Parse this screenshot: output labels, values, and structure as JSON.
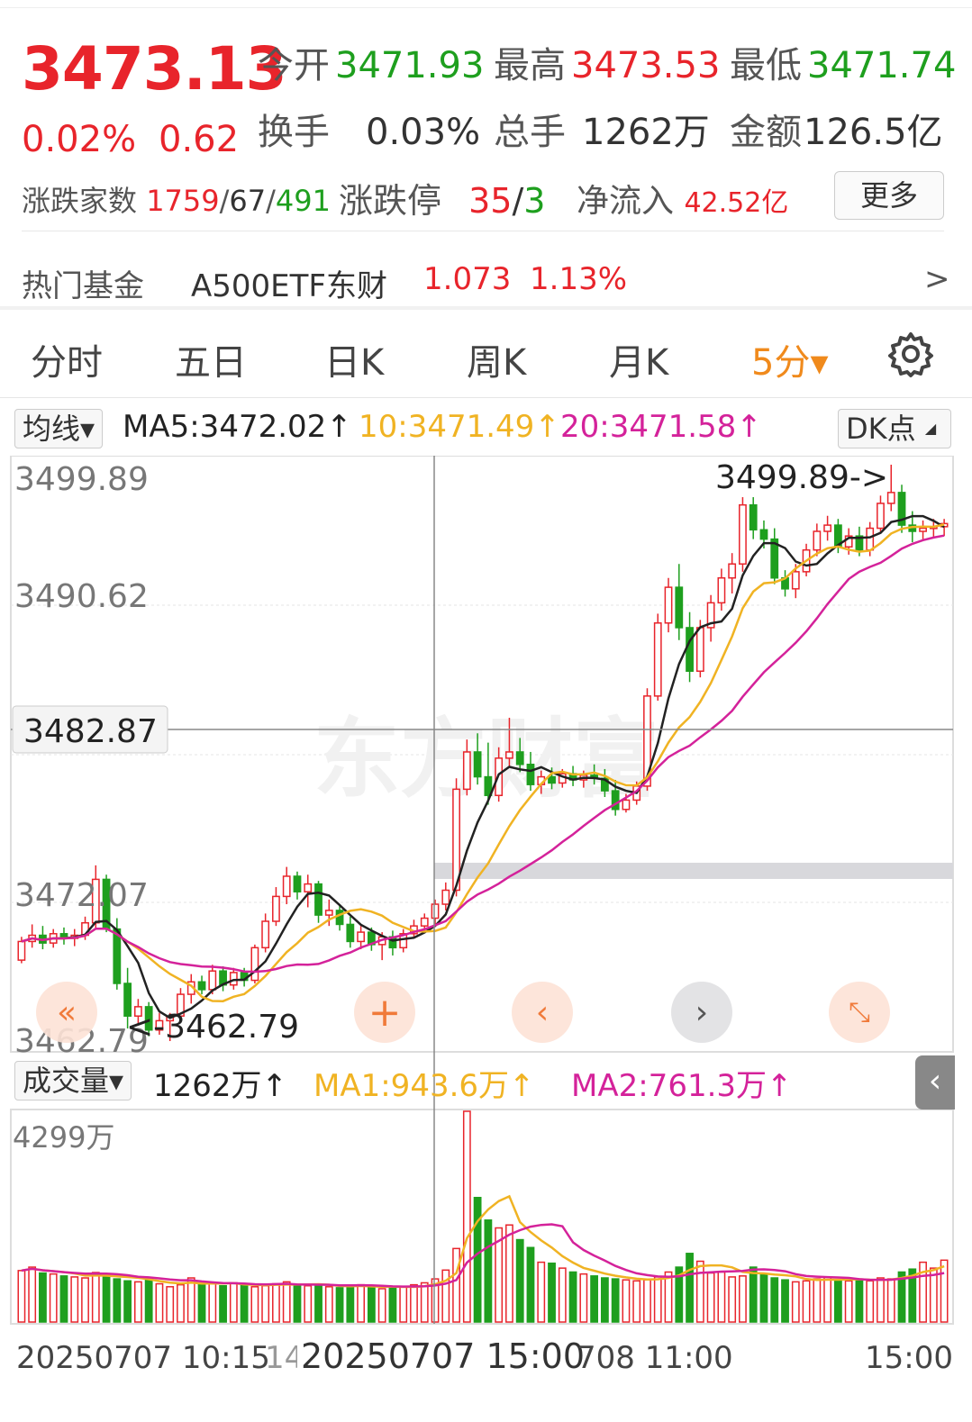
{
  "quote": {
    "price": "3473.13",
    "change_pct": "0.02%",
    "change_amt": "0.62",
    "open_label": "今开",
    "open_value": "3471.93",
    "high_label": "最高",
    "high_value": "3473.53",
    "low_label": "最低",
    "low_value": "3471.74",
    "turnover_label": "换手",
    "turnover_value": "0.03%",
    "volume_label": "总手",
    "volume_value": "1262万",
    "amount_label": "金额",
    "amount_value": "126.5亿",
    "breadth_label": "涨跌家数",
    "breadth_up": "1759",
    "breadth_flat": "67",
    "breadth_down": "491",
    "breadth_sep": "/",
    "limit_label": "涨跌停",
    "limit_up": "35",
    "limit_down": "3",
    "inflow_label": "净流入",
    "inflow_value": "42.52亿",
    "more_label": "更多"
  },
  "hot_fund": {
    "label": "热门基金",
    "name": "A500ETF东财",
    "price": "1.073",
    "pct": "1.13%",
    "arrow": ">"
  },
  "tabs": [
    {
      "label": "分时"
    },
    {
      "label": "五日"
    },
    {
      "label": "日K"
    },
    {
      "label": "周K"
    },
    {
      "label": "月K"
    },
    {
      "label": "5分▾"
    }
  ],
  "active_tab": "5分",
  "ma_bar": {
    "selector": "均线▾",
    "ma5": "MA5:3472.02↑",
    "ma10": "10:3471.49↑",
    "ma20": "20:3471.58↑",
    "dk": "DK点"
  },
  "price_axis": {
    "top": "3499.89",
    "mid1": "3490.62",
    "mid2": "3472.07",
    "bottom": "3462.79",
    "crosshair": "3482.87"
  },
  "annotations": {
    "max": "3499.89->",
    "min": "<-3462.79"
  },
  "volume_bar": {
    "selector": "成交量▾",
    "vol": "1262万↑",
    "ma1": "MA1:943.6万↑",
    "ma2": "MA2:761.3万↑",
    "axis_top": "4299万"
  },
  "x_axis": {
    "l1": "20250707 10:15",
    "l2": "20250707 15:00",
    "l3": "708 11:00",
    "l4": "15:00",
    "l5": "14"
  },
  "watermark": "东方财富",
  "colors": {
    "up": "#e8242b",
    "down": "#1e9f1e",
    "ma5": "#222222",
    "ma10": "#f0b323",
    "ma20": "#d4229a",
    "accent": "#f08a1c"
  },
  "icons": [
    "gear-icon",
    "double-left-icon",
    "plus-icon",
    "left-icon",
    "right-icon",
    "expand-icon",
    "collapse-icon"
  ],
  "chart_data": {
    "type": "candlestick",
    "title": "",
    "ylim": [
      3462.79,
      3499.89
    ],
    "series": [
      {
        "name": "MA5",
        "color": "#222222"
      },
      {
        "name": "10",
        "color": "#f0b323"
      },
      {
        "name": "20",
        "color": "#d4229a"
      }
    ],
    "candles_ohlc": [
      [
        3468,
        3469.5,
        3467.8,
        3469.2
      ],
      [
        3469.2,
        3470.3,
        3468.8,
        3469.6
      ],
      [
        3469.6,
        3470.2,
        3468.7,
        3469.1
      ],
      [
        3469.1,
        3470.0,
        3468.8,
        3469.7
      ],
      [
        3469.7,
        3470.1,
        3469.0,
        3469.4
      ],
      [
        3469.4,
        3470.0,
        3468.9,
        3469.6
      ],
      [
        3469.6,
        3470.8,
        3469.3,
        3470.4
      ],
      [
        3470.4,
        3474.1,
        3470.0,
        3473.2
      ],
      [
        3473.2,
        3473.5,
        3469.8,
        3470.0
      ],
      [
        3470.0,
        3470.7,
        3466.1,
        3466.5
      ],
      [
        3466.5,
        3467.5,
        3463.6,
        3464.4
      ],
      [
        3464.4,
        3465.5,
        3463.8,
        3465.0
      ],
      [
        3465.0,
        3465.3,
        3463.1,
        3463.5
      ],
      [
        3463.5,
        3464.6,
        3463.2,
        3464.1
      ],
      [
        3464.1,
        3464.6,
        3462.79,
        3464.4
      ],
      [
        3464.4,
        3466.2,
        3464.0,
        3465.8
      ],
      [
        3465.8,
        3467.1,
        3465.2,
        3466.6
      ],
      [
        3466.6,
        3467.0,
        3465.8,
        3466.1
      ],
      [
        3466.1,
        3467.7,
        3465.8,
        3467.3
      ],
      [
        3467.3,
        3467.6,
        3466.0,
        3466.4
      ],
      [
        3466.4,
        3467.5,
        3466.1,
        3467.2
      ],
      [
        3467.2,
        3467.5,
        3466.3,
        3466.7
      ],
      [
        3466.7,
        3469.0,
        3466.5,
        3468.8
      ],
      [
        3468.8,
        3471.0,
        3468.5,
        3470.5
      ],
      [
        3470.5,
        3472.7,
        3470.2,
        3472.1
      ],
      [
        3472.1,
        3474.0,
        3471.6,
        3473.4
      ],
      [
        3473.4,
        3473.7,
        3471.9,
        3472.4
      ],
      [
        3472.4,
        3473.5,
        3471.4,
        3472.9
      ],
      [
        3472.9,
        3473.1,
        3470.4,
        3470.9
      ],
      [
        3470.9,
        3471.9,
        3470.2,
        3471.2
      ],
      [
        3471.2,
        3471.6,
        3469.9,
        3470.3
      ],
      [
        3470.3,
        3470.8,
        3468.8,
        3469.2
      ],
      [
        3469.2,
        3470.2,
        3468.7,
        3469.8
      ],
      [
        3469.8,
        3470.1,
        3468.6,
        3469.0
      ],
      [
        3469.0,
        3469.8,
        3468.0,
        3469.5
      ],
      [
        3469.5,
        3469.9,
        3468.3,
        3468.8
      ],
      [
        3468.8,
        3470.0,
        3468.5,
        3469.7
      ],
      [
        3469.7,
        3470.6,
        3469.4,
        3470.2
      ],
      [
        3470.2,
        3471.0,
        3469.8,
        3470.7
      ],
      [
        3470.7,
        3471.9,
        3470.3,
        3471.6
      ],
      [
        3471.6,
        3473.0,
        3471.2,
        3472.5
      ],
      [
        3472.5,
        3479.7,
        3472.1,
        3479.0
      ],
      [
        3479.0,
        3482.2,
        3478.6,
        3481.4
      ],
      [
        3481.4,
        3482.6,
        3479.3,
        3479.8
      ],
      [
        3479.8,
        3482.0,
        3478.0,
        3478.6
      ],
      [
        3478.6,
        3481.7,
        3478.2,
        3481.0
      ],
      [
        3481.0,
        3483.6,
        3480.5,
        3481.4
      ],
      [
        3481.4,
        3482.3,
        3480.1,
        3480.6
      ],
      [
        3480.6,
        3481.4,
        3478.9,
        3479.3
      ],
      [
        3479.3,
        3480.2,
        3478.7,
        3479.8
      ],
      [
        3479.8,
        3480.4,
        3479.0,
        3479.4
      ],
      [
        3479.4,
        3480.3,
        3479.1,
        3480.0
      ],
      [
        3480.0,
        3480.5,
        3479.2,
        3479.6
      ],
      [
        3479.6,
        3480.2,
        3479.1,
        3479.9
      ],
      [
        3479.9,
        3480.6,
        3479.3,
        3479.7
      ],
      [
        3479.7,
        3480.3,
        3478.5,
        3478.9
      ],
      [
        3478.9,
        3479.6,
        3477.3,
        3477.7
      ],
      [
        3477.7,
        3478.7,
        3477.5,
        3478.3
      ],
      [
        3478.3,
        3479.5,
        3478.0,
        3479.2
      ],
      [
        3479.2,
        3485.5,
        3478.9,
        3485.0
      ],
      [
        3485.0,
        3490.3,
        3484.7,
        3489.7
      ],
      [
        3489.7,
        3492.6,
        3489.1,
        3492.0
      ],
      [
        3492.0,
        3493.5,
        3488.6,
        3489.4
      ],
      [
        3489.4,
        3490.4,
        3485.9,
        3486.6
      ],
      [
        3486.6,
        3489.9,
        3486.2,
        3489.4
      ],
      [
        3489.4,
        3491.5,
        3488.5,
        3491.0
      ],
      [
        3491.0,
        3493.2,
        3490.5,
        3492.6
      ],
      [
        3492.6,
        3494.2,
        3491.6,
        3493.5
      ],
      [
        3493.5,
        3497.8,
        3493.0,
        3497.3
      ],
      [
        3497.3,
        3497.8,
        3495.1,
        3495.7
      ],
      [
        3495.7,
        3496.3,
        3494.5,
        3495.1
      ],
      [
        3495.1,
        3495.8,
        3492.2,
        3492.6
      ],
      [
        3492.6,
        3493.1,
        3491.4,
        3491.9
      ],
      [
        3491.9,
        3493.5,
        3491.3,
        3493.0
      ],
      [
        3493.0,
        3494.8,
        3492.7,
        3494.4
      ],
      [
        3494.4,
        3496.1,
        3494.0,
        3495.6
      ],
      [
        3495.6,
        3496.6,
        3495.0,
        3496.0
      ],
      [
        3496.0,
        3496.4,
        3494.2,
        3494.6
      ],
      [
        3494.6,
        3495.8,
        3494.1,
        3495.3
      ],
      [
        3495.3,
        3495.9,
        3494.0,
        3494.4
      ],
      [
        3494.4,
        3496.2,
        3494.0,
        3495.8
      ],
      [
        3495.8,
        3497.9,
        3495.5,
        3497.4
      ],
      [
        3497.4,
        3499.89,
        3496.9,
        3498.1
      ],
      [
        3498.1,
        3498.6,
        3495.5,
        3496.0
      ],
      [
        3496.0,
        3496.9,
        3494.9,
        3495.6
      ],
      [
        3495.6,
        3496.3,
        3495.0,
        3495.8
      ],
      [
        3495.8,
        3496.4,
        3495.2,
        3495.9
      ],
      [
        3495.9,
        3496.4,
        3495.3,
        3496.1
      ]
    ],
    "volume_wan": [
      1050,
      1120,
      1000,
      980,
      940,
      920,
      900,
      1010,
      960,
      880,
      840,
      820,
      860,
      780,
      720,
      760,
      900,
      760,
      780,
      740,
      800,
      760,
      720,
      740,
      780,
      820,
      760,
      740,
      760,
      720,
      700,
      740,
      760,
      720,
      680,
      700,
      720,
      760,
      800,
      880,
      1060,
      1500,
      4299,
      2540,
      2080,
      1920,
      1980,
      1680,
      1520,
      1220,
      1200,
      1100,
      1020,
      980,
      940,
      900,
      880,
      860,
      840,
      860,
      920,
      1020,
      1120,
      1400,
      1240,
      1000,
      1020,
      920,
      940,
      1120,
      960,
      900,
      860,
      820,
      840,
      880,
      920,
      860,
      840,
      860,
      840,
      900,
      880,
      1020,
      1080,
      1220,
      1100,
      1262
    ],
    "volume_ma1_wan": 943.6,
    "volume_ma2_wan": 761.3
  }
}
